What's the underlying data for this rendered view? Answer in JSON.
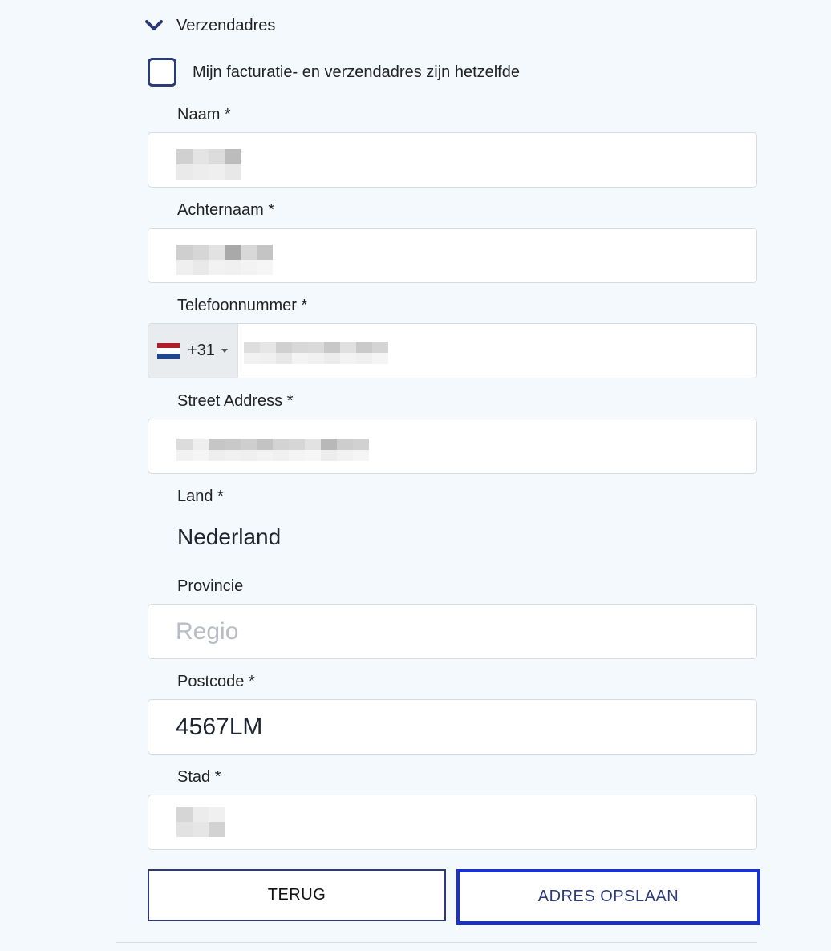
{
  "section": {
    "title": "Verzendadres",
    "icon": "chevron-down-icon"
  },
  "same_address": {
    "label": "Mijn facturatie- en verzendadres zijn hetzelfde",
    "checked": false
  },
  "fields": {
    "first_name": {
      "label": "Naam *"
    },
    "last_name": {
      "label": "Achternaam *"
    },
    "phone": {
      "label": "Telefoonnummer *",
      "dial_code": "+31",
      "flag": "nl-flag-icon"
    },
    "street": {
      "label": "Street Address *"
    },
    "country": {
      "label": "Land *",
      "value": "Nederland"
    },
    "province": {
      "label": "Provincie",
      "placeholder": "Regio",
      "value": ""
    },
    "postcode": {
      "label": "Postcode *",
      "value": "4567LM"
    },
    "city": {
      "label": "Stad *"
    }
  },
  "buttons": {
    "back": "TERUG",
    "save": "ADRES OPSLAAN"
  },
  "colors": {
    "accent": "#1a32cc",
    "checkbox_border": "#2b3a78",
    "background": "#f4f9fd"
  }
}
